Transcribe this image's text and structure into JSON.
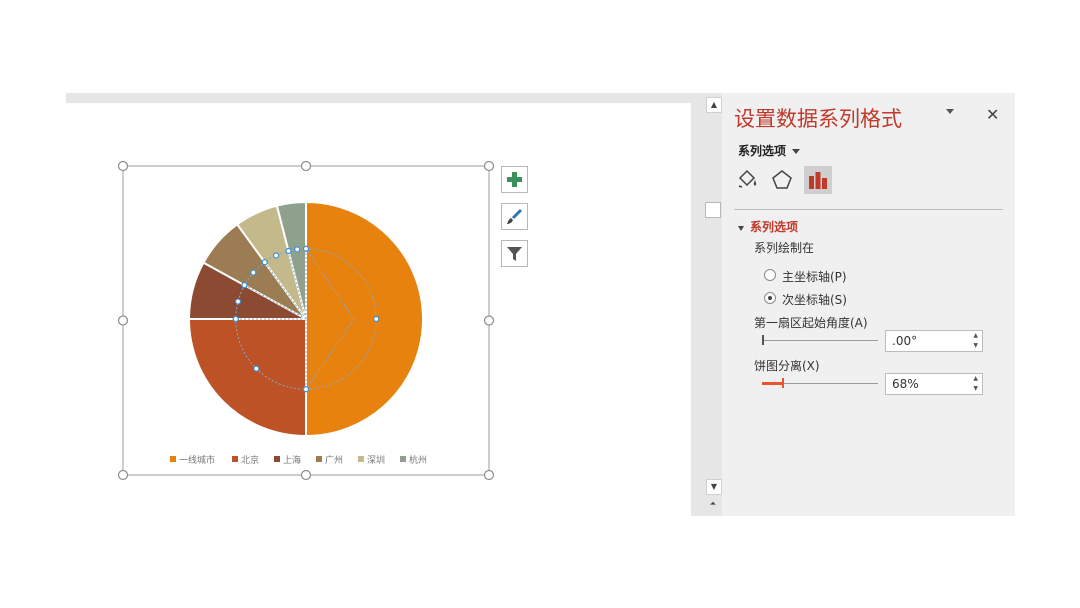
{
  "pane": {
    "title": "设置数据系列格式",
    "options_menu_label": "系列选项",
    "section_title": "系列选项",
    "plot_on_label": "系列绘制在",
    "primary_axis_label": "主坐标轴(P)",
    "secondary_axis_label": "次坐标轴(S)",
    "selected_axis": "secondary",
    "first_slice_angle_label": "第一扇区起始角度(A)",
    "first_slice_angle_value": ".00°",
    "first_slice_angle": 0,
    "explosion_label": "饼图分离(X)",
    "explosion_value": "68%",
    "explosion": 68,
    "tabs": [
      "fill-line-icon",
      "effects-icon",
      "series-options-icon"
    ],
    "active_tab": "series-options-icon"
  },
  "chart_side_buttons": [
    "plus-icon",
    "brush-icon",
    "filter-icon"
  ],
  "chart_data": {
    "type": "pie",
    "title": "",
    "categories": [
      "一线城市",
      "北京",
      "上海",
      "广州",
      "深圳",
      "杭州"
    ],
    "values": [
      50,
      25,
      8,
      7,
      6,
      4
    ],
    "colors": [
      "#E8820E",
      "#BC5225",
      "#8B4A31",
      "#9C7C52",
      "#C4B98A",
      "#8FA18C"
    ],
    "legend_position": "bottom"
  }
}
